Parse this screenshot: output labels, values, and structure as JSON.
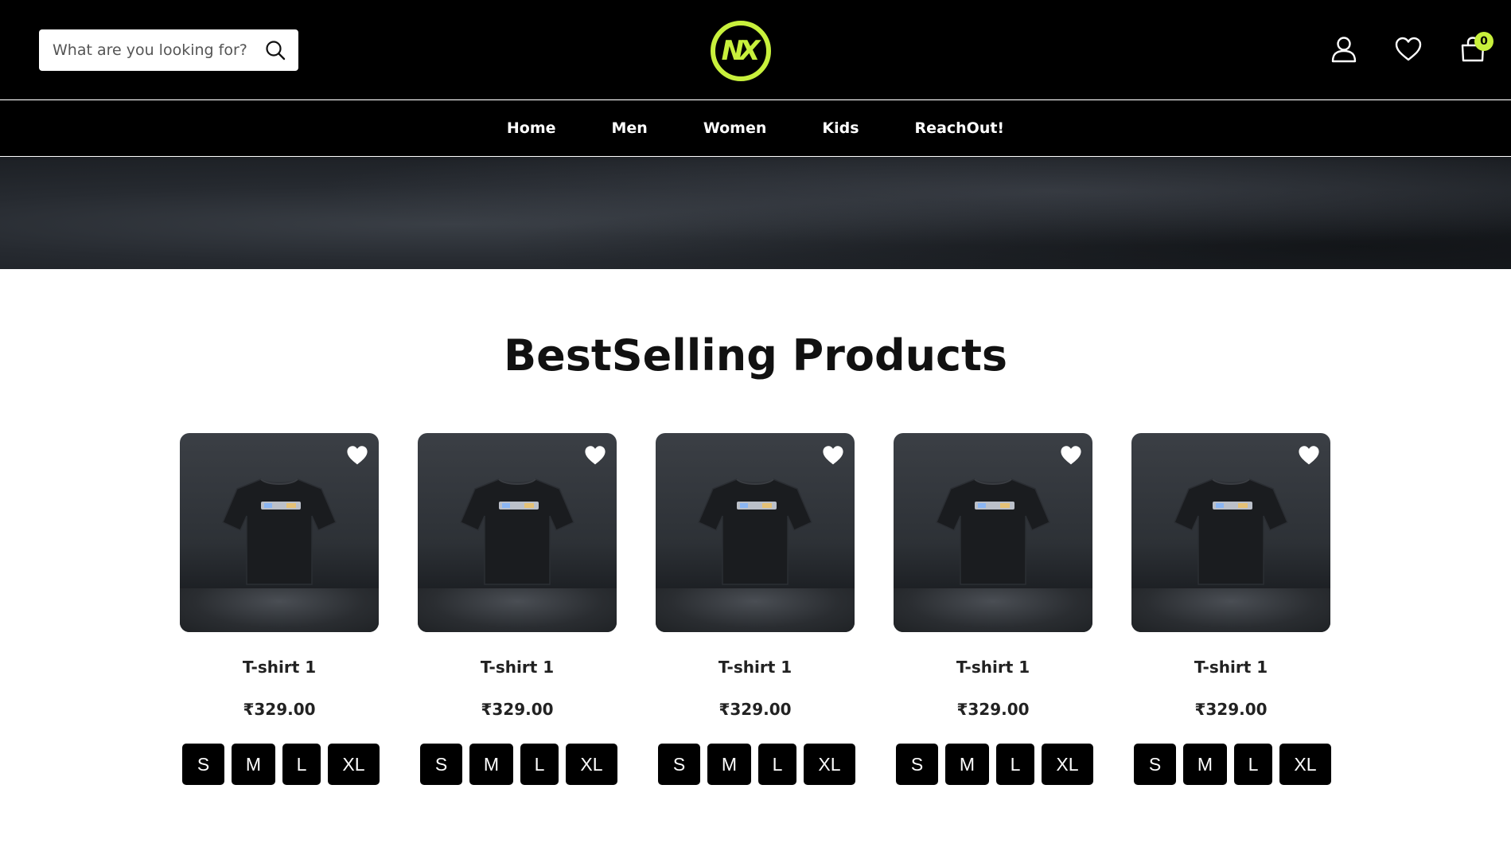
{
  "header": {
    "search_placeholder": "What are you looking for?",
    "logo_text": "NX",
    "cart_count": "0",
    "accent_color": "#c8f03c"
  },
  "nav": {
    "items": [
      "Home",
      "Men",
      "Women",
      "Kids",
      "ReachOut!"
    ]
  },
  "section": {
    "title": "BestSelling Products"
  },
  "products": [
    {
      "name": "T-shirt 1",
      "price": "₹329.00",
      "sizes": [
        "S",
        "M",
        "L",
        "XL"
      ]
    },
    {
      "name": "T-shirt 1",
      "price": "₹329.00",
      "sizes": [
        "S",
        "M",
        "L",
        "XL"
      ]
    },
    {
      "name": "T-shirt 1",
      "price": "₹329.00",
      "sizes": [
        "S",
        "M",
        "L",
        "XL"
      ]
    },
    {
      "name": "T-shirt 1",
      "price": "₹329.00",
      "sizes": [
        "S",
        "M",
        "L",
        "XL"
      ]
    },
    {
      "name": "T-shirt 1",
      "price": "₹329.00",
      "sizes": [
        "S",
        "M",
        "L",
        "XL"
      ]
    }
  ],
  "icons": {
    "search": "search-icon",
    "user": "user-icon",
    "wishlist": "heart-icon",
    "cart": "shopping-bag-icon"
  }
}
